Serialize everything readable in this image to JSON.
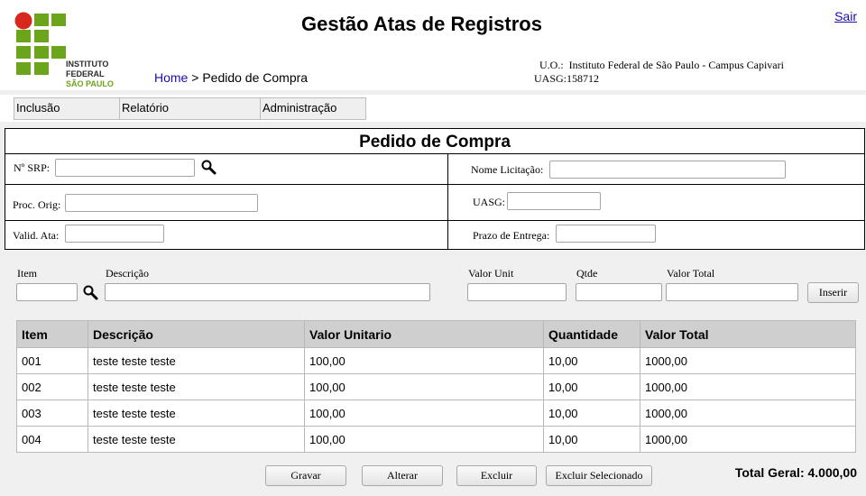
{
  "header": {
    "logo": {
      "line1": "INSTITUTO FEDERAL",
      "line2": "SÃO PAULO"
    },
    "title": "Gestão Atas de Registros",
    "logout": "Sair",
    "breadcrumb": {
      "home": "Home",
      "separator": " > ",
      "current": "Pedido de Compra"
    },
    "uo_label": "U.O.:",
    "uo_value": "Instituto Federal de São Paulo - Campus Capivari",
    "uasg_label": "UASG:",
    "uasg_value": "158712"
  },
  "menu": {
    "inclusao": "Inclusão",
    "relatorio": "Relatório",
    "administracao": "Administração"
  },
  "form": {
    "title": "Pedido de Compra",
    "srp_label": "Nº SRP:",
    "nome_licitacao_label": "Nome Licitação:",
    "proc_orig_label": "Proc. Orig:",
    "uasg_label": "UASG:",
    "valid_ata_label": "Valid. Ata:",
    "prazo_entrega_label": "Prazo de Entrega:",
    "srp_value": "",
    "nome_licitacao_value": "",
    "proc_orig_value": "",
    "uasg_value": "",
    "valid_ata_value": "",
    "prazo_entrega_value": ""
  },
  "item_entry": {
    "item_label": "Item",
    "descricao_label": "Descrição",
    "valor_unit_label": "Valor Unit",
    "qtde_label": "Qtde",
    "valor_total_label": "Valor Total",
    "inserir": "Inserir",
    "item_value": "",
    "descricao_value": "",
    "valor_unit_value": "",
    "qtde_value": "",
    "valor_total_value": ""
  },
  "table": {
    "headers": {
      "item": "Item",
      "descricao": "Descrição",
      "valor_unitario": "Valor Unitario",
      "quantidade": "Quantidade",
      "valor_total": "Valor Total"
    },
    "rows": [
      {
        "item": "001",
        "descricao": "teste teste teste",
        "valor_unitario": "100,00",
        "quantidade": "10,00",
        "valor_total": "1000,00"
      },
      {
        "item": "002",
        "descricao": "teste teste teste",
        "valor_unitario": "100,00",
        "quantidade": "10,00",
        "valor_total": "1000,00"
      },
      {
        "item": "003",
        "descricao": "teste teste teste",
        "valor_unitario": "100,00",
        "quantidade": "10,00",
        "valor_total": "1000,00"
      },
      {
        "item": "004",
        "descricao": "teste teste teste",
        "valor_unitario": "100,00",
        "quantidade": "10,00",
        "valor_total": "1000,00"
      }
    ]
  },
  "actions": {
    "gravar": "Gravar",
    "alterar": "Alterar",
    "excluir": "Excluir",
    "excluir_selecionado": "Excluir Selecionado"
  },
  "total_geral": "Total Geral: 4.000,00",
  "icons": {
    "logo": "institution-logo",
    "search": "magnifier-icon"
  },
  "colors": {
    "logo_green": "#6aa51c",
    "logo_red": "#d8271c",
    "link": "#1a0dab",
    "table_header": "#cfcfcf"
  }
}
